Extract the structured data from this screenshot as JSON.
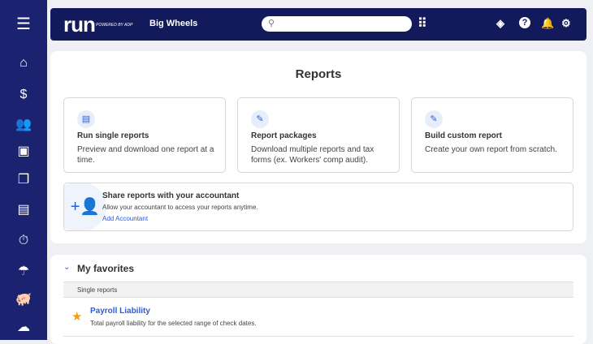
{
  "sidebar": {
    "items": [
      {
        "icon": "menu-icon"
      },
      {
        "icon": "home-icon"
      },
      {
        "icon": "dollar-icon"
      },
      {
        "icon": "people-icon"
      },
      {
        "icon": "cards-icon"
      },
      {
        "icon": "documents-icon"
      },
      {
        "icon": "money-check-icon"
      },
      {
        "icon": "stopwatch-icon"
      },
      {
        "icon": "umbrella-icon"
      },
      {
        "icon": "piggy-bank-icon"
      },
      {
        "icon": "cloud-icon"
      }
    ]
  },
  "header": {
    "logo": "run",
    "powered_by": "POWERED BY ADP",
    "company": "Big Wheels",
    "search_placeholder": ""
  },
  "reports": {
    "title": "Reports",
    "cards": [
      {
        "title": "Run single reports",
        "desc": "Preview and download one report at a time."
      },
      {
        "title": "Report packages",
        "desc": "Download multiple reports and tax forms (ex. Workers' comp audit)."
      },
      {
        "title": "Build custom report",
        "desc": "Create your own report from scratch."
      }
    ],
    "share": {
      "title": "Share reports with your accountant",
      "desc": "Allow your accountant to access your reports anytime.",
      "link": "Add Accountant"
    }
  },
  "favorites": {
    "title": "My favorites",
    "section": "Single reports",
    "items": [
      {
        "title": "Payroll Liability",
        "desc": "Total payroll liability for the selected range of check dates."
      }
    ]
  },
  "colors": {
    "sidebar": "#1b2371",
    "header": "#121a5c",
    "link": "#2e5bd7",
    "star": "#f39c12"
  }
}
